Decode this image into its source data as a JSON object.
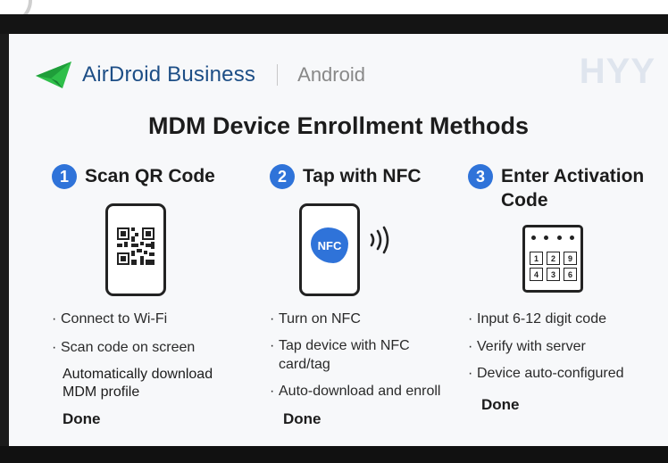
{
  "header": {
    "brand": "AirDroid Business",
    "platform": "Android",
    "watermark": "HYY"
  },
  "title": "MDM Device Enrollment Methods",
  "colors": {
    "accent": "#2f73d9",
    "brand_text": "#1d4e86",
    "logo_green": "#2fbf4a"
  },
  "methods": [
    {
      "number": "1",
      "title": "Scan QR Code",
      "icon": "qr-phone-icon",
      "steps": [
        "Connect to Wi-Fi",
        "Scan code on screen"
      ],
      "note": [
        "Automatically download",
        "MDM profile"
      ],
      "done": "Done"
    },
    {
      "number": "2",
      "title": "Tap with NFC",
      "icon": "nfc-phone-icon",
      "nfc_label": "NFC",
      "steps": [
        "Turn on NFC",
        "Tap device with NFC",
        "card/tag",
        "Auto-download and enroll"
      ],
      "done": "Done"
    },
    {
      "number": "3",
      "title_lines": [
        "Enter Activation",
        "Code"
      ],
      "icon": "keypad-icon",
      "keys": [
        "1",
        "2",
        "9",
        "4",
        "3",
        "6"
      ],
      "steps": [
        "Input 6-12 digit code",
        "Verify with server",
        "Device auto-configured"
      ],
      "done": "Done"
    }
  ]
}
